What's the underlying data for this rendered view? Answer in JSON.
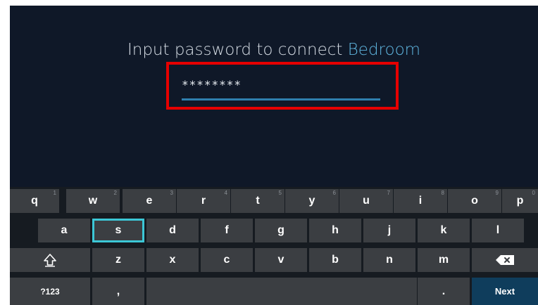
{
  "prompt": {
    "prefix": "Input password to connect ",
    "network": "Bedroom"
  },
  "password_field": {
    "value": "********"
  },
  "keyboard": {
    "row1": [
      {
        "label": "q",
        "hint": "1"
      },
      {
        "label": "w",
        "hint": "2"
      },
      {
        "label": "e",
        "hint": "3"
      },
      {
        "label": "r",
        "hint": "4"
      },
      {
        "label": "t",
        "hint": "5"
      },
      {
        "label": "y",
        "hint": "6"
      },
      {
        "label": "u",
        "hint": "7"
      },
      {
        "label": "i",
        "hint": "8"
      },
      {
        "label": "o",
        "hint": "9"
      },
      {
        "label": "p",
        "hint": "0"
      }
    ],
    "row2": [
      "a",
      "s",
      "d",
      "f",
      "g",
      "h",
      "j",
      "k",
      "l"
    ],
    "row3": [
      "z",
      "x",
      "c",
      "v",
      "b",
      "n",
      "m"
    ],
    "symbols_label": "?123",
    "comma_label": ",",
    "period_label": ".",
    "next_label": "Next",
    "shift_icon": "shift-icon",
    "backspace_icon": "backspace-icon",
    "focused_key": "s"
  },
  "colors": {
    "background": "#0f1828",
    "accent": "#5fb6e0",
    "highlight": "#e60000",
    "focus": "#3cc7d6"
  }
}
